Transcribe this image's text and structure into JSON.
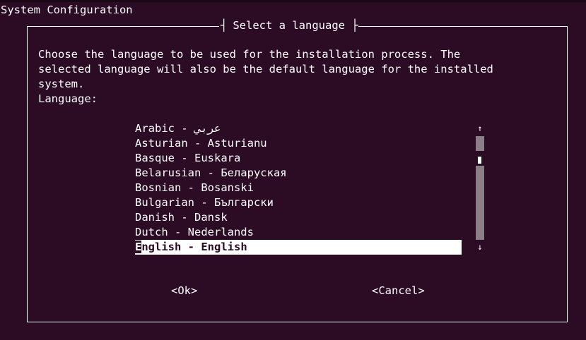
{
  "terminal": {
    "title": "System Configuration"
  },
  "dialog": {
    "title": "Select a language",
    "prompt_lines": [
      "Choose the language to be used for the installation process. The",
      "selected language will also be the default language for the installed",
      "system."
    ],
    "list_label": "Language:",
    "languages": [
      "Arabic - عربي",
      "Asturian - Asturianu",
      "Basque - Euskara",
      "Belarusian - Беларуская",
      "Bosnian - Bosanski",
      "Bulgarian - Български",
      "Danish - Dansk",
      "Dutch - Nederlands",
      "English - English"
    ],
    "selected_index": 8,
    "scroll": {
      "up_arrow": "↑",
      "down_arrow": "↓"
    },
    "buttons": {
      "ok": "<Ok>",
      "cancel": "<Cancel>"
    }
  },
  "colors": {
    "background": "#2c0b24",
    "foreground": "#ffffff",
    "scrollbar": "#8a7f86",
    "highlight": "#ffffff"
  }
}
